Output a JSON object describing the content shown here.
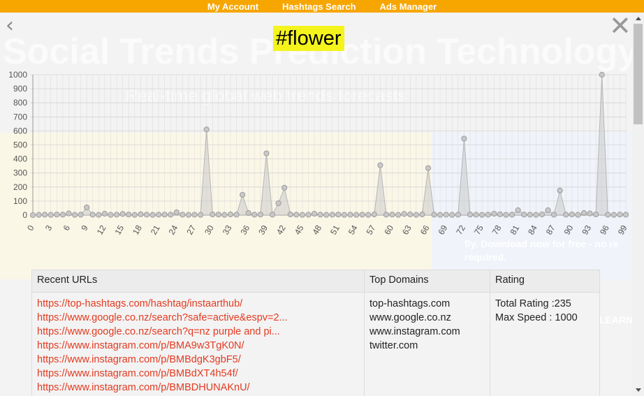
{
  "topnav": {
    "items": [
      "My Account",
      "Hashtags Search",
      "Ads Manager"
    ]
  },
  "background": {
    "title": "Social Trends Prediction Technology",
    "subtitle": "Real-time global web trends forecasts",
    "right_text": "fly. Download now for free - no re required.",
    "learn": "LEARN"
  },
  "modal": {
    "hashtag": "#flower"
  },
  "chart_data": {
    "type": "line",
    "ylim": [
      0,
      1000
    ],
    "yticks": [
      0,
      100,
      200,
      300,
      400,
      500,
      600,
      700,
      800,
      900,
      1000
    ],
    "xticks": [
      0,
      3,
      6,
      9,
      12,
      15,
      18,
      21,
      24,
      27,
      30,
      33,
      36,
      39,
      42,
      45,
      48,
      51,
      54,
      57,
      60,
      63,
      66,
      69,
      72,
      75,
      78,
      81,
      84,
      87,
      90,
      93,
      96,
      99
    ],
    "x": [
      0,
      1,
      2,
      3,
      4,
      5,
      6,
      7,
      8,
      9,
      10,
      11,
      12,
      13,
      14,
      15,
      16,
      17,
      18,
      19,
      20,
      21,
      22,
      23,
      24,
      25,
      26,
      27,
      28,
      29,
      30,
      31,
      32,
      33,
      34,
      35,
      36,
      37,
      38,
      39,
      40,
      41,
      42,
      43,
      44,
      45,
      46,
      47,
      48,
      49,
      50,
      51,
      52,
      53,
      54,
      55,
      56,
      57,
      58,
      59,
      60,
      61,
      62,
      63,
      64,
      65,
      66,
      67,
      68,
      69,
      70,
      71,
      72,
      73,
      74,
      75,
      76,
      77,
      78,
      79,
      80,
      81,
      82,
      83,
      84,
      85,
      86,
      87,
      88,
      89,
      90,
      91,
      92,
      93,
      94,
      95,
      96,
      97,
      98,
      99
    ],
    "values": [
      0,
      2,
      3,
      2,
      4,
      3,
      12,
      2,
      3,
      55,
      3,
      2,
      10,
      2,
      3,
      8,
      4,
      2,
      6,
      3,
      2,
      3,
      4,
      3,
      20,
      3,
      2,
      3,
      2,
      610,
      5,
      4,
      2,
      5,
      3,
      145,
      15,
      3,
      4,
      440,
      3,
      85,
      195,
      5,
      3,
      2,
      3,
      10,
      3,
      2,
      3,
      4,
      2,
      3,
      2,
      3,
      2,
      5,
      355,
      3,
      4,
      2,
      8,
      5,
      2,
      5,
      335,
      3,
      2,
      3,
      2,
      3,
      545,
      4,
      3,
      2,
      3,
      10,
      6,
      2,
      3,
      35,
      4,
      3,
      2,
      5,
      35,
      3,
      175,
      3,
      5,
      2,
      15,
      12,
      5,
      1000,
      3,
      2,
      4,
      3
    ],
    "grid": true
  },
  "table": {
    "headers": [
      "Recent URLs",
      "Top Domains",
      "Rating"
    ],
    "urls": [
      "https://top-hashtags.com/hashtag/instaarthub/",
      "https://www.google.co.nz/search?safe=active&espv=2...",
      "https://www.google.co.nz/search?q=nz purple and pi...",
      "https://www.instagram.com/p/BMA9w3TgK0N/",
      "https://www.instagram.com/p/BMBdgK3gbF5/",
      "https://www.instagram.com/p/BMBdXT4h54f/",
      "https://www.instagram.com/p/BMBDHUNAKnU/"
    ],
    "domains": [
      "top-hashtags.com",
      "www.google.co.nz",
      "www.instagram.com",
      "twitter.com"
    ],
    "rating": {
      "total": "Total Rating :235",
      "max_speed": "Max Speed : 1000"
    }
  }
}
